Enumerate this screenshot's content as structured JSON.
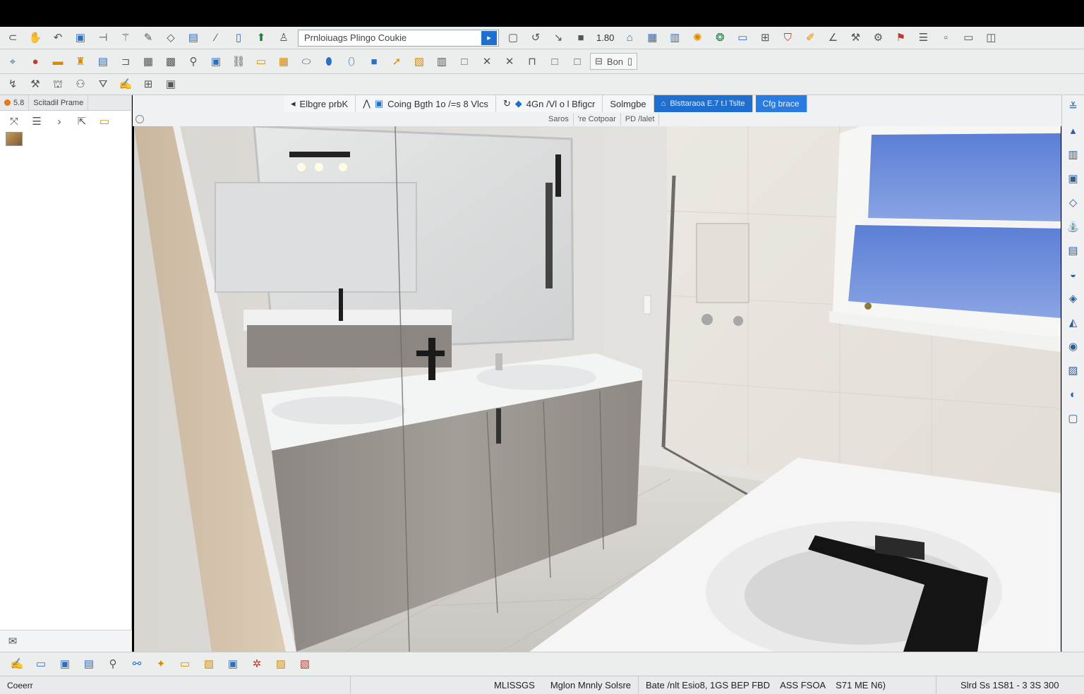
{
  "toolbar1": {
    "search_value": "Prnloiuags Plingo Coukie",
    "zoom_value": "1.80",
    "icons": [
      "lasso-icon",
      "hand-icon",
      "rotate-icon",
      "square-icon",
      "bracket-icon",
      "wand-icon",
      "brush-icon",
      "pointer-icon",
      "cabinet-icon",
      "curve-icon",
      "door-icon",
      "paint-icon",
      "person-icon"
    ]
  },
  "toolbar2": {
    "field_label": "Bon"
  },
  "left_panel": {
    "tab1": "5.8",
    "tab2": "Scitadil Prame"
  },
  "view_tabs": {
    "t1": "Elbgre prbK",
    "t2": "Coing Bgth 1o /=s 8 Vlcs",
    "t3": "4Gn /Vl o l Bfigcr",
    "t4": "Solmgbe",
    "t5": "Blsttaraoa E.7 t.l Tslte",
    "t6": "Cfg brace"
  },
  "view_subtabs": {
    "s1": "Saros",
    "s2": "'re Cotpoar",
    "s3": "PD /lalet"
  },
  "status": {
    "s1": "Coeerr",
    "s2": "MLISSGS",
    "s3": "Mglon Mnnly Solsre",
    "s4": "Bate /nlt Esio8, 1GS BEP FBD",
    "s5": "ASS FSOA",
    "s6": "S71 ME N6)",
    "s7": "Slrd Ss 1S81 -  3 3S 300"
  },
  "colors": {
    "accent": "#1f6fd1",
    "toolbar_bg": "#eceded",
    "sky": "#6f8fd9"
  }
}
